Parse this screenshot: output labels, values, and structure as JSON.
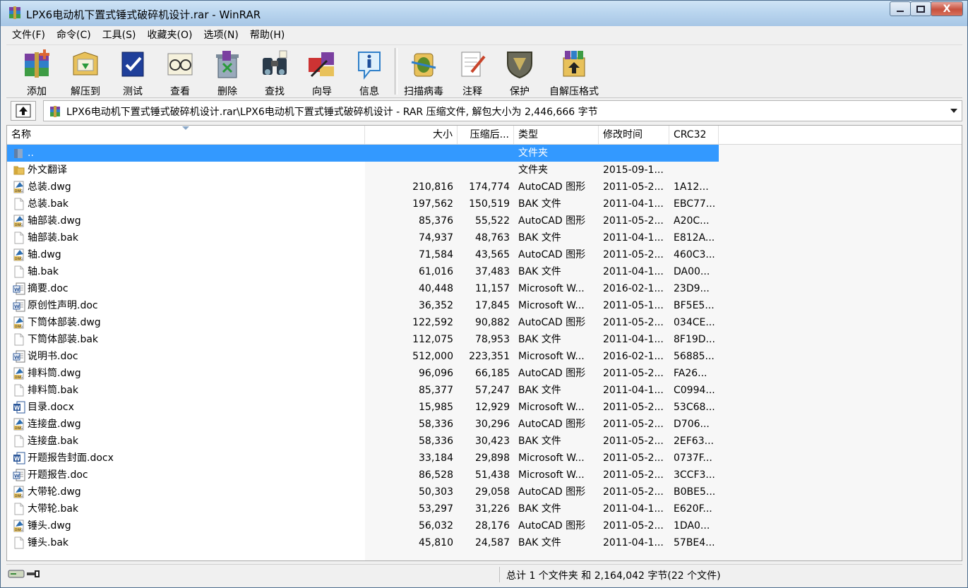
{
  "window": {
    "title": "LPX6电动机下置式锤式破碎机设计.rar - WinRAR",
    "minimize": "minimize",
    "maximize": "maximize",
    "close": "X"
  },
  "menu": [
    "文件(F)",
    "命令(C)",
    "工具(S)",
    "收藏夹(O)",
    "选项(N)",
    "帮助(H)"
  ],
  "toolbar": [
    {
      "label": "添加",
      "icon": "add-archive-icon"
    },
    {
      "label": "解压到",
      "icon": "extract-to-icon"
    },
    {
      "label": "测试",
      "icon": "test-icon"
    },
    {
      "label": "查看",
      "icon": "view-icon"
    },
    {
      "label": "删除",
      "icon": "delete-icon"
    },
    {
      "label": "查找",
      "icon": "find-icon"
    },
    {
      "label": "向导",
      "icon": "wizard-icon"
    },
    {
      "label": "信息",
      "icon": "info-icon"
    },
    {
      "label": "扫描病毒",
      "icon": "virus-scan-icon"
    },
    {
      "label": "注释",
      "icon": "comment-icon"
    },
    {
      "label": "保护",
      "icon": "protect-icon"
    },
    {
      "label": "自解压格式",
      "icon": "sfx-icon"
    }
  ],
  "address": {
    "path": "LPX6电动机下置式锤式破碎机设计.rar\\LPX6电动机下置式锤式破碎机设计 - RAR 压缩文件, 解包大小为 2,446,666 字节"
  },
  "columns": {
    "name": "名称",
    "size": "大小",
    "packed": "压缩后...",
    "type": "类型",
    "modified": "修改时间",
    "crc": "CRC32"
  },
  "files": [
    {
      "name": "..",
      "size": "",
      "packed": "",
      "type": "文件夹",
      "modified": "",
      "crc": "",
      "kind": "up"
    },
    {
      "name": "外文翻译",
      "size": "",
      "packed": "",
      "type": "文件夹",
      "modified": "2015-09-1...",
      "crc": "",
      "kind": "folder"
    },
    {
      "name": "总装.dwg",
      "size": "210,816",
      "packed": "174,774",
      "type": "AutoCAD 图形",
      "modified": "2011-05-2...",
      "crc": "1A12...",
      "kind": "dwg"
    },
    {
      "name": "总装.bak",
      "size": "197,562",
      "packed": "150,519",
      "type": "BAK 文件",
      "modified": "2011-04-1...",
      "crc": "EBC77...",
      "kind": "bak"
    },
    {
      "name": "轴部装.dwg",
      "size": "85,376",
      "packed": "55,522",
      "type": "AutoCAD 图形",
      "modified": "2011-05-2...",
      "crc": "A20C...",
      "kind": "dwg"
    },
    {
      "name": "轴部装.bak",
      "size": "74,937",
      "packed": "48,763",
      "type": "BAK 文件",
      "modified": "2011-04-1...",
      "crc": "E812A...",
      "kind": "bak"
    },
    {
      "name": "轴.dwg",
      "size": "71,584",
      "packed": "43,565",
      "type": "AutoCAD 图形",
      "modified": "2011-05-2...",
      "crc": "460C3...",
      "kind": "dwg"
    },
    {
      "name": "轴.bak",
      "size": "61,016",
      "packed": "37,483",
      "type": "BAK 文件",
      "modified": "2011-04-1...",
      "crc": "DA00...",
      "kind": "bak"
    },
    {
      "name": "摘要.doc",
      "size": "40,448",
      "packed": "11,157",
      "type": "Microsoft W...",
      "modified": "2016-02-1...",
      "crc": "23D9...",
      "kind": "doc"
    },
    {
      "name": "原创性声明.doc",
      "size": "36,352",
      "packed": "17,845",
      "type": "Microsoft W...",
      "modified": "2011-05-1...",
      "crc": "BF5E5...",
      "kind": "doc"
    },
    {
      "name": "下筒体部装.dwg",
      "size": "122,592",
      "packed": "90,882",
      "type": "AutoCAD 图形",
      "modified": "2011-05-2...",
      "crc": "034CE...",
      "kind": "dwg"
    },
    {
      "name": "下筒体部装.bak",
      "size": "112,075",
      "packed": "78,953",
      "type": "BAK 文件",
      "modified": "2011-04-1...",
      "crc": "8F19D...",
      "kind": "bak"
    },
    {
      "name": "说明书.doc",
      "size": "512,000",
      "packed": "223,351",
      "type": "Microsoft W...",
      "modified": "2016-02-1...",
      "crc": "56885...",
      "kind": "doc"
    },
    {
      "name": "排料筒.dwg",
      "size": "96,096",
      "packed": "66,185",
      "type": "AutoCAD 图形",
      "modified": "2011-05-2...",
      "crc": "FA26...",
      "kind": "dwg"
    },
    {
      "name": "排料筒.bak",
      "size": "85,377",
      "packed": "57,247",
      "type": "BAK 文件",
      "modified": "2011-04-1...",
      "crc": "C0994...",
      "kind": "bak"
    },
    {
      "name": "目录.docx",
      "size": "15,985",
      "packed": "12,929",
      "type": "Microsoft W...",
      "modified": "2011-05-2...",
      "crc": "53C68...",
      "kind": "docx"
    },
    {
      "name": "连接盘.dwg",
      "size": "58,336",
      "packed": "30,296",
      "type": "AutoCAD 图形",
      "modified": "2011-05-2...",
      "crc": "D706...",
      "kind": "dwg"
    },
    {
      "name": "连接盘.bak",
      "size": "58,336",
      "packed": "30,423",
      "type": "BAK 文件",
      "modified": "2011-05-2...",
      "crc": "2EF63...",
      "kind": "bak"
    },
    {
      "name": "开题报告封面.docx",
      "size": "33,184",
      "packed": "29,898",
      "type": "Microsoft W...",
      "modified": "2011-05-2...",
      "crc": "0737F...",
      "kind": "docx"
    },
    {
      "name": "开题报告.doc",
      "size": "86,528",
      "packed": "51,438",
      "type": "Microsoft W...",
      "modified": "2011-05-2...",
      "crc": "3CCF3...",
      "kind": "doc"
    },
    {
      "name": "大带轮.dwg",
      "size": "50,303",
      "packed": "29,058",
      "type": "AutoCAD 图形",
      "modified": "2011-05-2...",
      "crc": "B0BE5...",
      "kind": "dwg"
    },
    {
      "name": "大带轮.bak",
      "size": "53,297",
      "packed": "31,226",
      "type": "BAK 文件",
      "modified": "2011-04-1...",
      "crc": "E620F...",
      "kind": "bak"
    },
    {
      "name": "锤头.dwg",
      "size": "56,032",
      "packed": "28,176",
      "type": "AutoCAD 图形",
      "modified": "2011-05-2...",
      "crc": "1DA0...",
      "kind": "dwg"
    },
    {
      "name": "锤头.bak",
      "size": "45,810",
      "packed": "24,587",
      "type": "BAK 文件",
      "modified": "2011-04-1...",
      "crc": "57BE4...",
      "kind": "bak"
    }
  ],
  "selected_index": 0,
  "status": {
    "summary": "总计 1 个文件夹 和 2,164,042 字节(22 个文件)"
  },
  "colors": {
    "selection": "#3399ff",
    "titlebar": "#b8d4ee",
    "folder": "#e8c15a",
    "word_blue": "#2b579a"
  }
}
